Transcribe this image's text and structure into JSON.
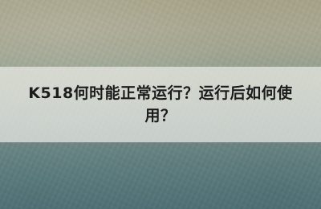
{
  "banner": {
    "title": "K518何时能正常运行？运行后如何使用？"
  },
  "colors": {
    "background_top": "#a7a389",
    "background_bottom": "#557a80",
    "banner_fill": "#ececE6",
    "title_text": "#1c1c1c"
  }
}
